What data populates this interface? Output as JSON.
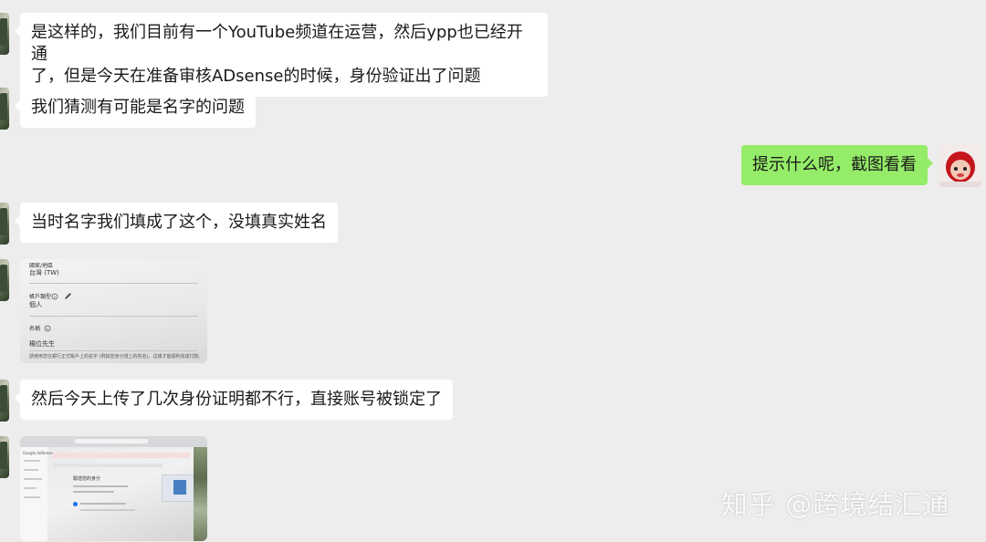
{
  "messages": [
    {
      "side": "left",
      "type": "text",
      "text": "是这样的，我们目前有一个YouTube频道在运营，然后ypp也已经开通\n了，但是今天在准备审核ADsense的时候，身份验证出了问题"
    },
    {
      "side": "left",
      "type": "text",
      "text": "我们猜测有可能是名字的问题"
    },
    {
      "side": "right",
      "type": "text",
      "text": "提示什么呢，截图看看"
    },
    {
      "side": "left",
      "type": "text",
      "text": "当时名字我们填成了这个，没填真实姓名"
    },
    {
      "side": "left",
      "type": "image",
      "image": {
        "label_region": "國家/地區",
        "value_region": "台灣 (TW)",
        "label_account_type": "帳戶類型",
        "value_account_type": "個人",
        "label_name": "名稱",
        "value_name": "楊位先生",
        "footnote": "請使用您在銀行正式帳戶上的名字 (例如您身分證上的姓名)，這樣才能順利完成付款。"
      }
    },
    {
      "side": "left",
      "type": "text",
      "text": "然后今天上传了几次身份证明都不行，直接账号被锁定了"
    },
    {
      "side": "left",
      "type": "image",
      "image": {
        "app_name": "Google AdSense",
        "heading": "驗證您的身分"
      }
    }
  ],
  "watermark": "知乎 @跨境结汇通",
  "colors": {
    "background": "#ededed",
    "incoming_bubble": "#ffffff",
    "outgoing_bubble": "#95ec69"
  }
}
